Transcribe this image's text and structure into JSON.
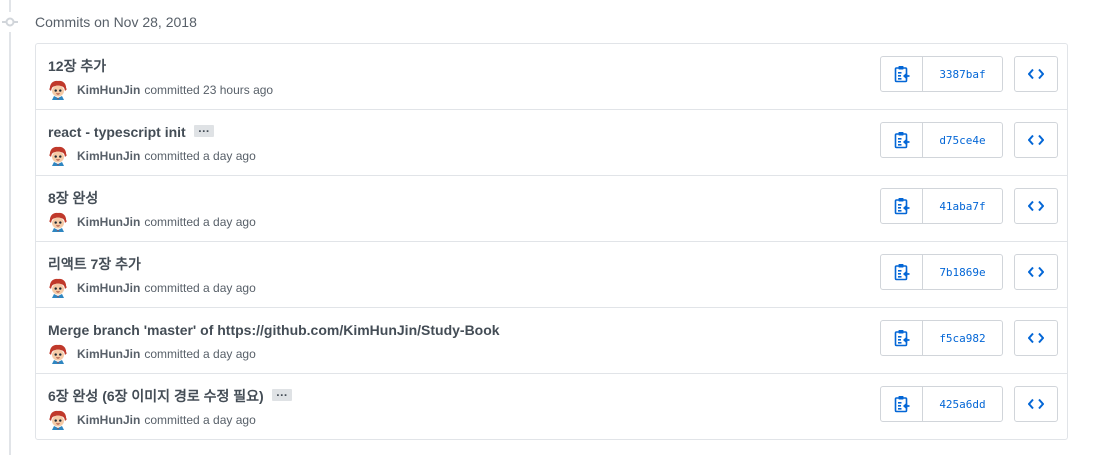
{
  "group": {
    "title": "Commits on Nov 28, 2018"
  },
  "icons": {
    "timeline": "git-commit-icon",
    "copy": "clippy-icon",
    "browse": "code-icon"
  },
  "colors": {
    "link": "#0366d6",
    "border": "#e1e4e8",
    "muted": "#586069"
  },
  "commits": [
    {
      "title": "12장 추가",
      "has_ellipsis": false,
      "ellipsis": "",
      "author": "KimHunJin",
      "action": "committed",
      "time": "23 hours ago",
      "sha": "3387baf"
    },
    {
      "title": "react - typescript init",
      "has_ellipsis": true,
      "ellipsis": "…",
      "author": "KimHunJin",
      "action": "committed",
      "time": "a day ago",
      "sha": "d75ce4e"
    },
    {
      "title": "8장 완성",
      "has_ellipsis": false,
      "ellipsis": "",
      "author": "KimHunJin",
      "action": "committed",
      "time": "a day ago",
      "sha": "41aba7f"
    },
    {
      "title": "리액트 7장 추가",
      "has_ellipsis": false,
      "ellipsis": "",
      "author": "KimHunJin",
      "action": "committed",
      "time": "a day ago",
      "sha": "7b1869e"
    },
    {
      "title": "Merge branch 'master' of https://github.com/KimHunJin/Study-Book",
      "has_ellipsis": false,
      "ellipsis": "",
      "author": "KimHunJin",
      "action": "committed",
      "time": "a day ago",
      "sha": "f5ca982"
    },
    {
      "title": "6장 완성 (6장 이미지 경로 수정 필요)",
      "has_ellipsis": true,
      "ellipsis": "…",
      "author": "KimHunJin",
      "action": "committed",
      "time": "a day ago",
      "sha": "425a6dd"
    }
  ]
}
